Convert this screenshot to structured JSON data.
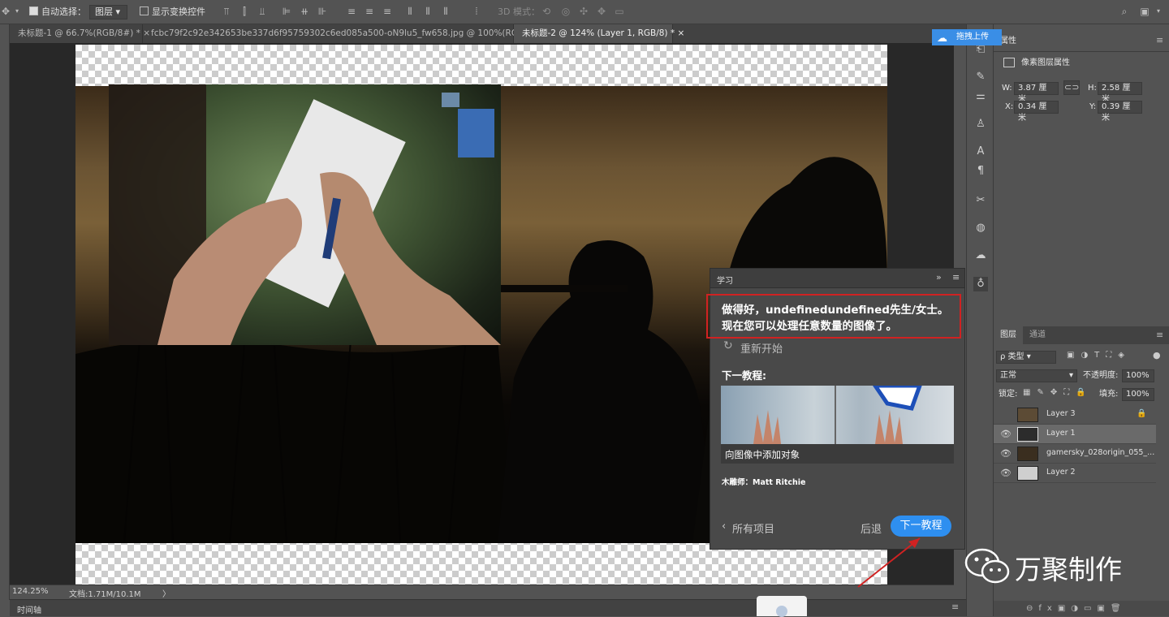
{
  "options_bar": {
    "auto_select_label": "自动选择：",
    "auto_select_value": "图层",
    "show_transform_label": "显示变换控件",
    "mode_3d_label": "3D 模式："
  },
  "tabs": [
    {
      "label": "未标题-1 @ 66.7%(RGB/8#) *",
      "close": "×"
    },
    {
      "label": "fcbc79f2c92e342653be337d6f95759302c6ed085a500-oN9lu5_fw658.jpg @ 100%(RGB/8#)",
      "close": "×"
    },
    {
      "label": "未标题-2 @ 124% (Layer 1, RGB/8) *",
      "close": "×"
    }
  ],
  "status": {
    "zoom": "124.25%",
    "doc": "文档:1.71M/10.1M",
    "arrow": "〉"
  },
  "timeline_label": "时间轴",
  "upload_button": "拖拽上传",
  "properties": {
    "tab": "属性",
    "title": "像素图层属性",
    "w_label": "W:",
    "w_value": "3.87 厘米",
    "h_label": "H:",
    "h_value": "2.58 厘米",
    "x_label": "X:",
    "x_value": "0.34 厘米",
    "y_label": "Y:",
    "y_value": "0.39 厘米"
  },
  "layers_panel": {
    "tab_layers": "图层",
    "tab_channels": "通道",
    "filter": "ρ 类型",
    "blend_mode": "正常",
    "opacity_label": "不透明度:",
    "opacity_value": "100%",
    "lock_label": "锁定:",
    "fill_label": "填充:",
    "fill_value": "100%",
    "layers": [
      {
        "name": "Layer 3",
        "visible": false,
        "locked": true
      },
      {
        "name": "Layer 1",
        "visible": true,
        "selected": true
      },
      {
        "name": "gamersky_028origin_055_...",
        "visible": true
      },
      {
        "name": "Layer 2",
        "visible": true
      }
    ]
  },
  "learn_panel": {
    "title": "学习",
    "message": "做得好，undefinedundefined先生/女士。现在您可以处理任意数量的图像了。",
    "restart": "重新开始",
    "next_tutorial_heading": "下一教程:",
    "tutorial_caption": "向图像中添加对象",
    "author": "木雕师：Matt Ritchie",
    "all_projects": "所有项目",
    "back": "后退",
    "next_button": "下一教程"
  },
  "watermark": "万聚制作",
  "colors": {
    "accent": "#2e8ff0",
    "highlight_box": "#d02222"
  }
}
